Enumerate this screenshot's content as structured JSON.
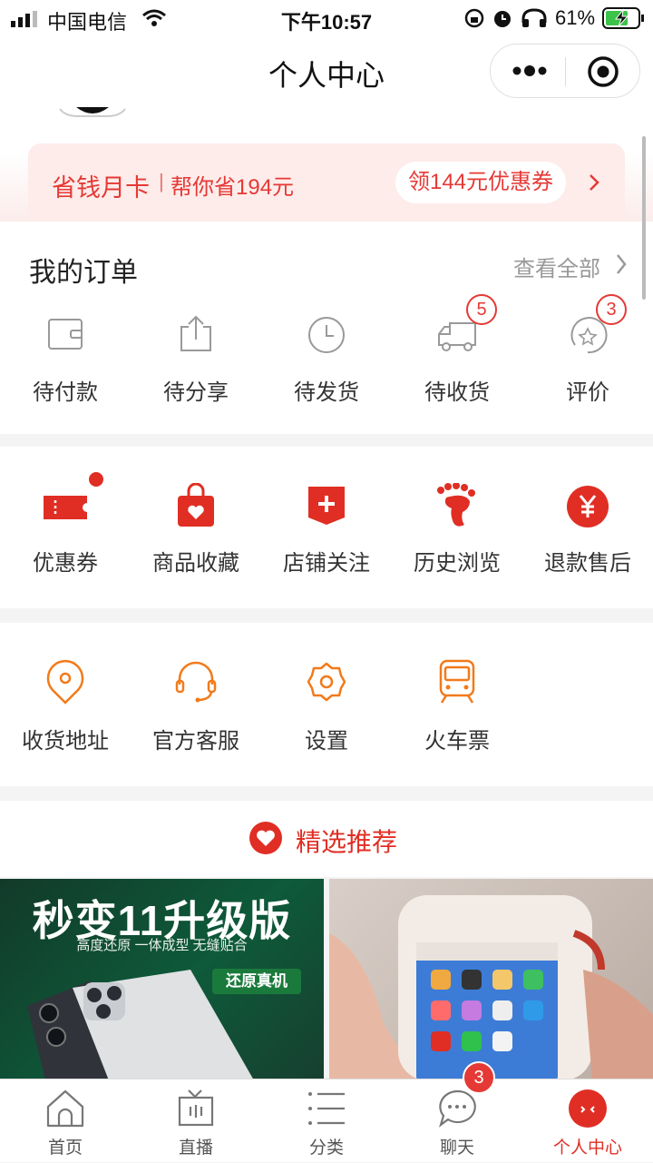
{
  "status_bar": {
    "carrier": "中国电信",
    "time": "下午10:57",
    "battery": "61%"
  },
  "navbar": {
    "title": "个人中心"
  },
  "banner": {
    "title": "省钱月卡",
    "divider": "|",
    "subtitle": "帮你省194元",
    "button": "领144元优惠券"
  },
  "orders": {
    "title": "我的订单",
    "view_all": "查看全部",
    "items": [
      {
        "label": "待付款",
        "icon": "wallet-icon"
      },
      {
        "label": "待分享",
        "icon": "share-icon"
      },
      {
        "label": "待发货",
        "icon": "clock-icon"
      },
      {
        "label": "待收货",
        "icon": "truck-icon",
        "badge": "5"
      },
      {
        "label": "评价",
        "icon": "star-comment-icon",
        "badge": "3"
      }
    ]
  },
  "services": {
    "items": [
      {
        "label": "优惠券",
        "icon": "coupon-icon"
      },
      {
        "label": "商品收藏",
        "icon": "favorite-bag-icon"
      },
      {
        "label": "店铺关注",
        "icon": "shop-follow-icon"
      },
      {
        "label": "历史浏览",
        "icon": "footprint-icon"
      },
      {
        "label": "退款售后",
        "icon": "yuan-refund-icon"
      }
    ]
  },
  "tools": {
    "items": [
      {
        "label": "收货地址",
        "icon": "location-icon"
      },
      {
        "label": "官方客服",
        "icon": "headset-icon"
      },
      {
        "label": "设置",
        "icon": "settings-icon"
      },
      {
        "label": "火车票",
        "icon": "train-icon"
      }
    ]
  },
  "recommend": {
    "title": "精选推荐",
    "products": [
      {
        "headline": "秒变11升级版",
        "tagline": "高度还原  一体成型  无缝贴合",
        "tag": "还原真机"
      },
      {
        "headline": ""
      }
    ]
  },
  "tabbar": {
    "items": [
      {
        "label": "首页",
        "icon": "home-icon"
      },
      {
        "label": "直播",
        "icon": "tv-icon"
      },
      {
        "label": "分类",
        "icon": "list-icon"
      },
      {
        "label": "聊天",
        "icon": "chat-icon",
        "badge": "3"
      },
      {
        "label": "个人中心",
        "icon": "profile-icon",
        "active": true
      }
    ]
  },
  "colors": {
    "accent": "#e02e24",
    "orange": "#f27a1a"
  }
}
